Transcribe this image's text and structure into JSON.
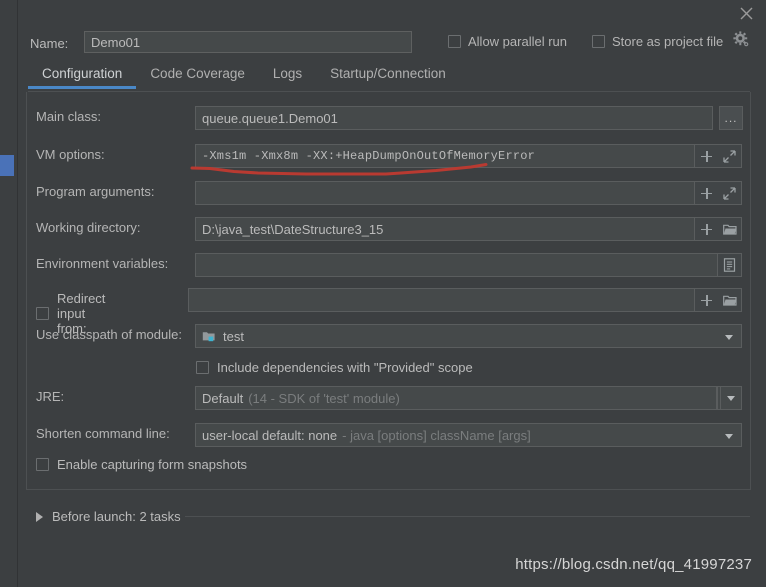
{
  "window": {
    "close_icon": "close-icon",
    "watermark": "https://blog.csdn.net/qq_41997237"
  },
  "name_row": {
    "label": "Name:",
    "value": "Demo01",
    "placeholder": "",
    "allow_parallel_run": "Allow parallel run",
    "store_as_project_file": "Store as project file",
    "gear_icon": "gear-icon"
  },
  "tabs": [
    {
      "label": "Configuration",
      "active": true
    },
    {
      "label": "Code Coverage",
      "active": false
    },
    {
      "label": "Logs",
      "active": false
    },
    {
      "label": "Startup/Connection",
      "active": false
    }
  ],
  "form": {
    "main_class": {
      "label": "Main class:",
      "value": "queue.queue1.Demo01",
      "browse_label": "..."
    },
    "vm_options": {
      "label": "VM options:",
      "value": "-Xms1m -Xmx8m -XX:+HeapDumpOnOutOfMemoryError",
      "macro_icon": "plus-icon",
      "expand_icon": "expand-icon"
    },
    "program_arguments": {
      "label": "Program arguments:",
      "value": "",
      "macro_icon": "plus-icon",
      "expand_icon": "expand-icon"
    },
    "working_directory": {
      "label": "Working directory:",
      "value": "D:\\java_test\\DateStructure3_15",
      "macro_icon": "plus-icon",
      "browse_icon": "folder-icon"
    },
    "environment_variables": {
      "label": "Environment variables:",
      "value": "",
      "browse_icon": "list-icon"
    },
    "redirect_input": {
      "label": "Redirect input from:",
      "checked": false,
      "value": "",
      "macro_icon": "plus-icon",
      "browse_icon": "folder-icon"
    },
    "classpath_module": {
      "label": "Use classpath of module:",
      "value": "test",
      "module_icon": "module-folder-icon"
    },
    "include_provided": {
      "label": "Include dependencies with \"Provided\" scope",
      "checked": false
    },
    "jre": {
      "label": "JRE:",
      "value": "Default",
      "value_detail": "(14 - SDK of 'test' module)",
      "browse_icon": "folder-icon"
    },
    "shorten_command_line": {
      "label": "Shorten command line:",
      "value": "user-local default: none",
      "value_detail": "- java [options] className [args]"
    },
    "form_snapshots": {
      "label": "Enable capturing form snapshots",
      "checked": false
    }
  },
  "before_launch": {
    "label": "Before launch: 2 tasks",
    "expander_icon": "triangle-right-icon"
  },
  "colors": {
    "background": "#3c3f41",
    "field_background": "#45494a",
    "accent_blue": "#4a88c7",
    "scroll_thumb": "#4a72b8",
    "annotation_red": "#b93a31",
    "module_badge": "#3eb3d0"
  }
}
